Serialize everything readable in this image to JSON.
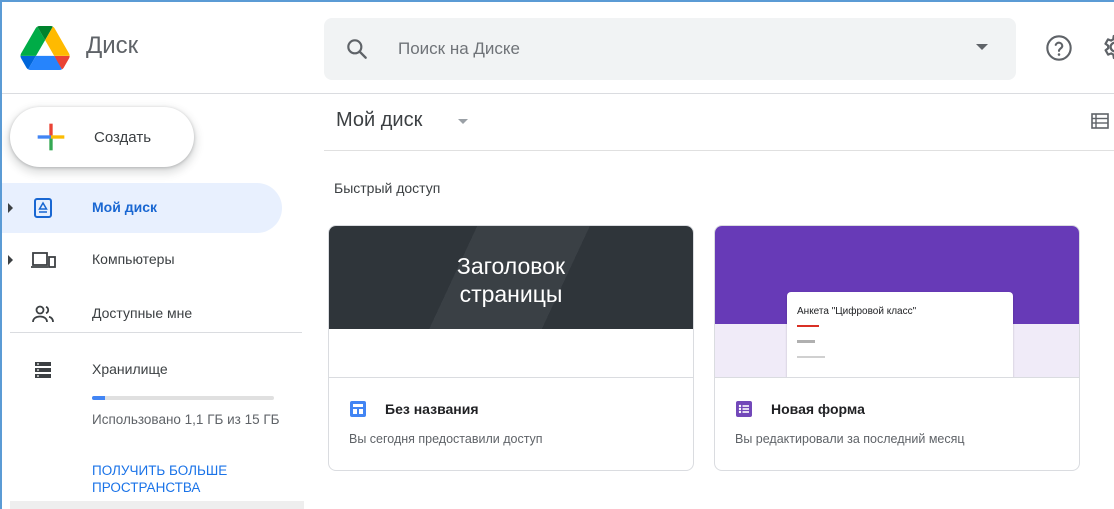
{
  "header": {
    "app_name": "Диск",
    "search_placeholder": "Поиск на Диске",
    "icons": {
      "help": "help-circle-icon",
      "settings": "gear-icon",
      "search": "search-icon"
    }
  },
  "sidebar": {
    "create_label": "Создать",
    "items": [
      {
        "label": "Мой диск",
        "icon": "my-drive-icon",
        "active": true
      },
      {
        "label": "Компьютеры",
        "icon": "computers-icon",
        "active": false
      },
      {
        "label": "Доступные мне",
        "icon": "shared-with-me-icon",
        "active": false
      },
      {
        "label": "Хранилище",
        "icon": "storage-icon",
        "active": false
      }
    ],
    "storage": {
      "used_text": "Использовано 1,1 ГБ из 15 ГБ",
      "used_fraction": 0.073,
      "upgrade_link": "Получить больше пространства"
    }
  },
  "main": {
    "breadcrumb": "Мой диск",
    "quick_access_title": "Быстрый доступ",
    "cards": [
      {
        "preview_title": "Заголовок\nстраницы",
        "name": "Без названия",
        "subtitle": "Вы сегодня предоставили доступ",
        "file_type_icon": "google-sites-icon"
      },
      {
        "preview_title": "Анкета \"Цифровой класс\"",
        "name": "Новая форма",
        "subtitle": "Вы редактировали за последний месяц",
        "file_type_icon": "google-forms-icon"
      }
    ]
  },
  "colors": {
    "accent": "#1a73e8",
    "active_bg": "#e8f0fe",
    "forms_purple": "#673ab7",
    "sites_dark": "#2f353a"
  }
}
